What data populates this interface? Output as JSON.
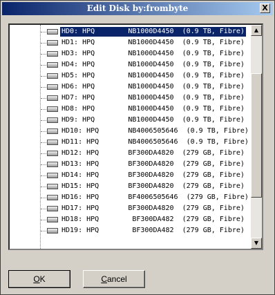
{
  "window": {
    "title": "Edit Disk by:frombyte",
    "close_label": "X"
  },
  "disks": [
    "HD0: HPQ        NB1000D4450  (0.9 TB, Fibre)",
    "HD1: HPQ        NB1000D4450  (0.9 TB, Fibre)",
    "HD3: HPQ        NB1000D4450  (0.9 TB, Fibre)",
    "HD4: HPQ        NB1000D4450  (0.9 TB, Fibre)",
    "HD5: HPQ        NB1000D4450  (0.9 TB, Fibre)",
    "HD6: HPQ        NB1000D4450  (0.9 TB, Fibre)",
    "HD7: HPQ        NB1000D4450  (0.9 TB, Fibre)",
    "HD8: HPQ        NB1000D4450  (0.9 TB, Fibre)",
    "HD9: HPQ        NB1000D4450  (0.9 TB, Fibre)",
    "HD10: HPQ       NB4006505646  (0.9 TB, Fibre)",
    "HD11: HPQ       NB4006505646  (0.9 TB, Fibre)",
    "HD12: HPQ       BF300DA4820  (279 GB, Fibre)",
    "HD13: HPQ       BF300DA4820  (279 GB, Fibre)",
    "HD14: HPQ       BF300DA4820  (279 GB, Fibre)",
    "HD15: HPQ       BF300DA4820  (279 GB, Fibre)",
    "HD16: HPQ       BF4006505646  (279 GB, Fibre)",
    "HD17: HPQ       BF300DA4820  (279 GB, Fibre)",
    "HD18: HPQ        BF300DA482  (279 GB, Fibre)",
    "HD19: HPQ        BF300DA482  (279 GB, Fibre)"
  ],
  "selected_index": 0,
  "buttons": {
    "ok_mnemonic": "O",
    "ok_rest": "K",
    "cancel_mnemonic": "C",
    "cancel_rest": "ancel"
  },
  "scrollbar": {
    "up_arrow": "▲",
    "down_arrow": "▼"
  }
}
